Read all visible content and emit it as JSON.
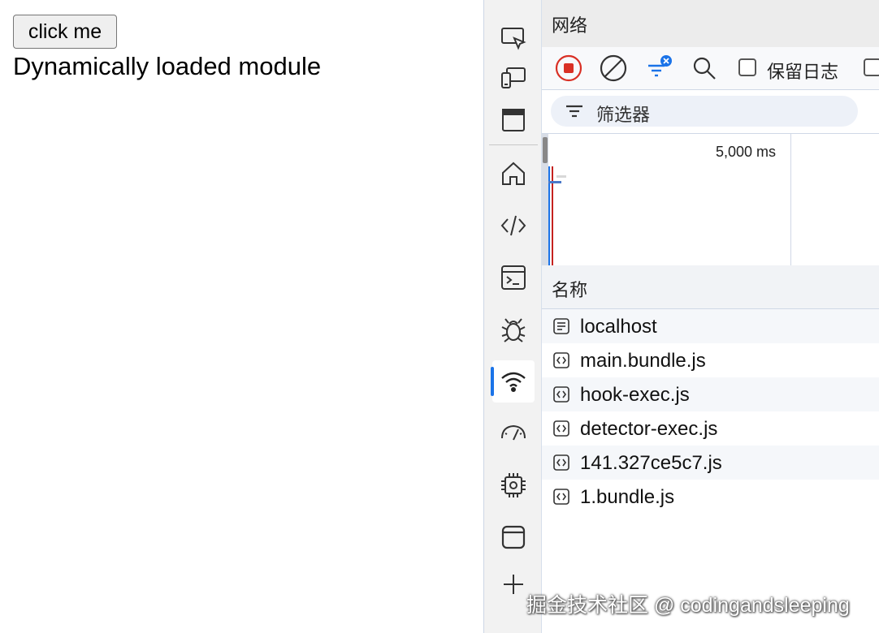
{
  "page": {
    "button_label": "click me",
    "dynamic_text": "Dynamically loaded module"
  },
  "activity_bar": {
    "items": [
      {
        "icon": "inspect-icon"
      },
      {
        "icon": "device-emulation-icon"
      },
      {
        "icon": "window-icon"
      },
      {
        "icon": "home-icon"
      },
      {
        "icon": "elements-code-icon"
      },
      {
        "icon": "console-icon"
      },
      {
        "icon": "debugger-bug-icon"
      },
      {
        "icon": "network-wifi-icon",
        "active": true
      },
      {
        "icon": "performance-gauge-icon"
      },
      {
        "icon": "memory-chip-icon"
      },
      {
        "icon": "application-icon"
      },
      {
        "icon": "add-icon"
      }
    ]
  },
  "devtools": {
    "panel_title": "网络",
    "toolbar": {
      "record_icon": "record-stop-icon",
      "clear_icon": "clear-icon",
      "filter_icon": "filter-toggle-icon",
      "search_icon": "search-icon",
      "preserve_log_label": "保留日志"
    },
    "filter_placeholder": "筛选器",
    "timeline": {
      "tick_label": "5,000 ms"
    },
    "columns": {
      "name": "名称"
    },
    "requests": [
      {
        "name": "localhost",
        "type": "document"
      },
      {
        "name": "main.bundle.js",
        "type": "script"
      },
      {
        "name": "hook-exec.js",
        "type": "script"
      },
      {
        "name": "detector-exec.js",
        "type": "script"
      },
      {
        "name": "141.327ce5c7.js",
        "type": "script"
      },
      {
        "name": "1.bundle.js",
        "type": "script"
      }
    ]
  },
  "watermark": "掘金技术社区 @ codingandsleeping",
  "colors": {
    "accent": "#1a73e8",
    "record_red": "#d93025",
    "filter_badge": "#1a73e8"
  }
}
